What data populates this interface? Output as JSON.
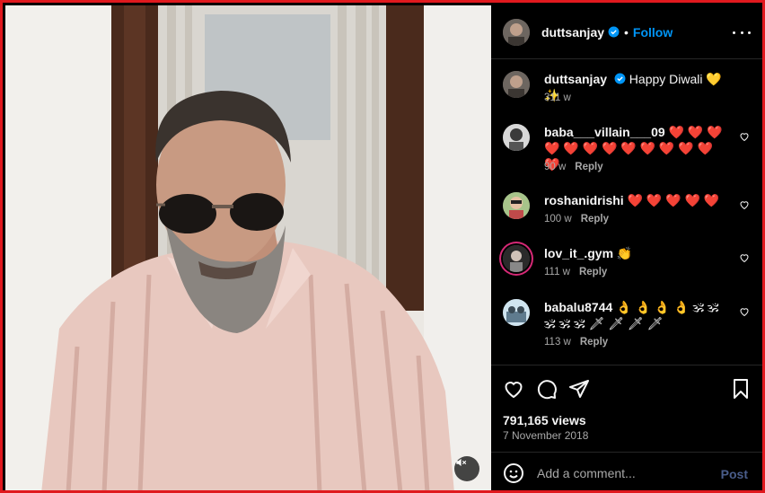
{
  "post": {
    "author": "duttsanjay",
    "follow_label": "Follow",
    "separator": "•",
    "more_icon": "more-horizontal-icon",
    "caption": {
      "text": "Happy Diwali 💛 ✨",
      "time": "311 w"
    }
  },
  "comments": [
    {
      "user": "baba___villain___09",
      "text": "❤️ ❤️ ❤️ ❤️ ❤️ ❤️ ❤️ ❤️ ❤️ ❤️ ❤️ ❤️ ❤️",
      "time": "90 w",
      "reply": "Reply"
    },
    {
      "user": "roshanidrishi",
      "text": "❤️ ❤️ ❤️ ❤️ ❤️",
      "time": "100 w",
      "reply": "Reply"
    },
    {
      "user": "lov_it_.gym",
      "text": "👏",
      "time": "111 w",
      "reply": "Reply"
    },
    {
      "user": "babalu8744",
      "text": "👌 👌 👌 👌 🕉 🕉 🕉 🕉 🕉 🗡 🗡 🗡 🗡",
      "time": "113 w",
      "reply": "Reply"
    }
  ],
  "stats": {
    "views": "791,165 views",
    "date": "7 November 2018"
  },
  "composer": {
    "placeholder": "Add a comment...",
    "post_label": "Post"
  },
  "icons": [
    "like-icon",
    "comment-icon",
    "share-icon",
    "save-icon",
    "emoji-icon",
    "mute-icon",
    "verified-icon"
  ],
  "colors": {
    "accent": "#0095f6",
    "frame_border": "#e0191e",
    "heart": "#ff3040",
    "post_disabled": "#4a5d8a"
  }
}
